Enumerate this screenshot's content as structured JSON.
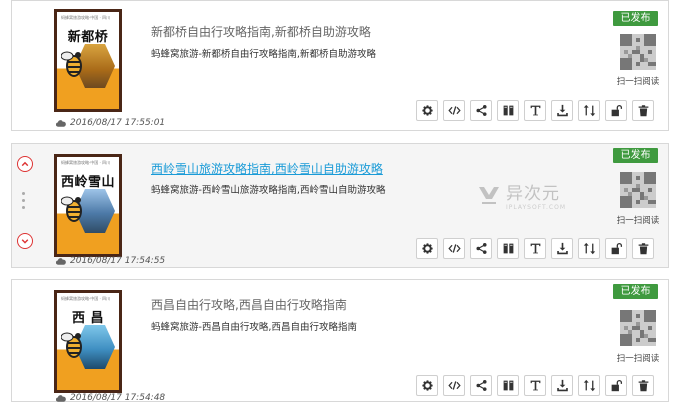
{
  "colors": {
    "accent": "#3f9a3f",
    "link": "#1a9bd7",
    "danger": "#dd3333"
  },
  "watermark": {
    "main": "异次元",
    "sub": "IPLAYSOFT.COM"
  },
  "toolbar_icons": [
    "gear-icon",
    "code-icon",
    "share-icon",
    "book-icon",
    "text-icon",
    "download-icon",
    "sort-icon",
    "unlock-icon",
    "trash-icon"
  ],
  "cards": [
    {
      "cover_brand": "蚂蜂窝旅游攻略·中国 · 四川",
      "cover_title": "新都桥",
      "title": "新都桥自由行攻略指南,新都桥自助游攻略",
      "description": "蚂蜂窝旅游-新都桥自由行攻略指南,新都桥自助游攻略",
      "status": "已发布",
      "qr_label": "扫一扫阅读",
      "timestamp": "2016/08/17 17:55:01"
    },
    {
      "cover_brand": "蚂蜂窝旅游攻略·中国 · 四川",
      "cover_title": "西岭雪山",
      "title": "西岭雪山旅游攻略指南,西岭雪山自助游攻略",
      "description": "蚂蜂窝旅游-西岭雪山旅游攻略指南,西岭雪山自助游攻略",
      "status": "已发布",
      "qr_label": "扫一扫阅读",
      "timestamp": "2016/08/17 17:54:55"
    },
    {
      "cover_brand": "蚂蜂窝旅游攻略·中国 · 四川",
      "cover_title": "西 昌",
      "title": "西昌自由行攻略,西昌自由行攻略指南",
      "description": "蚂蜂窝旅游-西昌自由行攻略,西昌自由行攻略指南",
      "status": "已发布",
      "qr_label": "扫一扫阅读",
      "timestamp": "2016/08/17 17:54:48"
    }
  ]
}
